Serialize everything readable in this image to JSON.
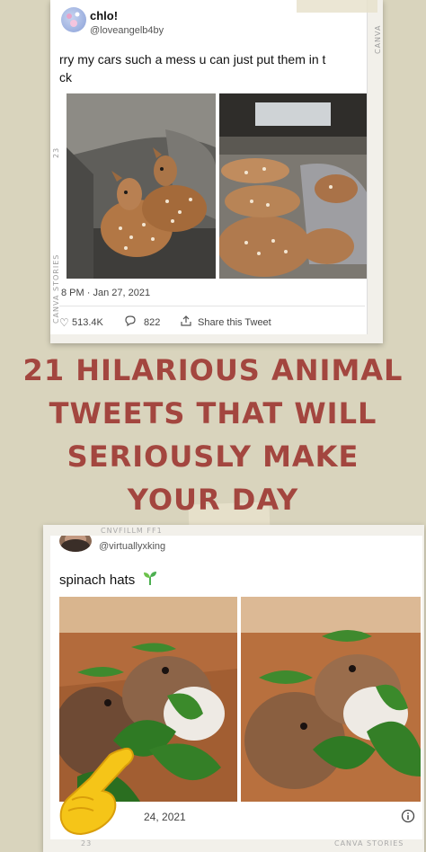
{
  "tweet1": {
    "name": "chlo!",
    "handle": "@loveangelb4by",
    "text_line1": "rry my cars such a mess u can just put them in t",
    "text_line2": "ck",
    "timestamp": "8 PM · Jan 27, 2021",
    "likes": "513.4K",
    "replies": "822",
    "share": "Share this Tweet",
    "side_label": "CANVA STORIES",
    "side_number": "23",
    "right_label": "CANVA STORIE"
  },
  "headline": {
    "line1": "21 HILARIOUS ANIMAL",
    "line2": "TWEETS THAT WILL",
    "line3": "SERIOUSLY MAKE",
    "line4": "YOUR DAY"
  },
  "tweet2": {
    "handle": "@virtuallyxking",
    "text": "spinach hats",
    "timestamp": "24, 2021",
    "timestamp_prefix": "2",
    "film_label": "CNVFILLM FF1",
    "bottom_number": "23",
    "bottom_label": "CANVA STORIES"
  },
  "colors": {
    "headline": "#a3463f",
    "background": "#d9d4bd"
  }
}
